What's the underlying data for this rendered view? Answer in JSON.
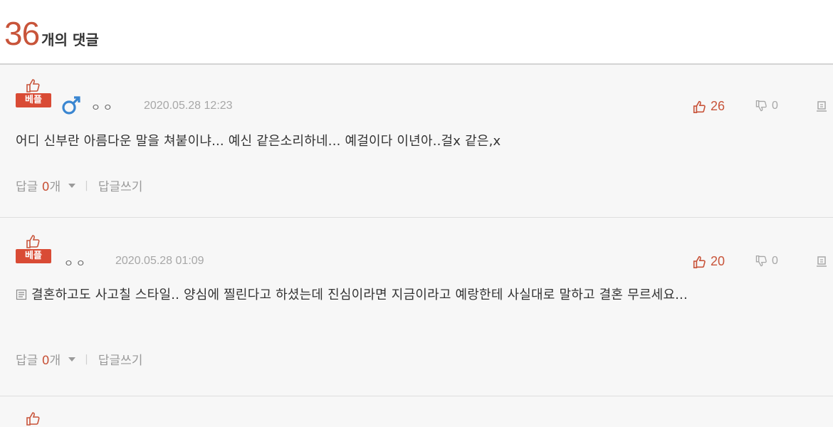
{
  "header": {
    "count": "36",
    "count_suffix": "개의 댓글"
  },
  "comments": [
    {
      "badge": "베플",
      "has_gender_icon": true,
      "author": "ㅇㅇ",
      "date": "2020.05.28 12:23",
      "likes": "26",
      "dislikes": "0",
      "text": "어디 신부란 아름다운 말을 쳐붙이냐... 예신 같은소리하네... 예걸이다 이년아..걸x 같은,x",
      "reply_label": "답글",
      "reply_count": "0",
      "reply_count_suffix": "개",
      "write_reply": "답글쓰기"
    },
    {
      "badge": "베플",
      "has_gender_icon": false,
      "author": "ㅇㅇ",
      "date": "2020.05.28 01:09",
      "likes": "20",
      "dislikes": "0",
      "text": "결혼하고도 사고칠 스타일.. 양심에 찔린다고 하셨는데 진심이라면 지금이라고 예랑한테 사실대로 말하고 결혼 무르세요...",
      "reply_label": "답글",
      "reply_count": "0",
      "reply_count_suffix": "개",
      "write_reply": "답글쓰기"
    }
  ],
  "icons": {
    "thumb": "thumbs-up-icon",
    "gender": "male-icon",
    "like": "thumbs-up-icon",
    "dislike": "thumbs-down-icon",
    "report": "report-icon",
    "doc": "document-icon",
    "caret": "caret-down-icon"
  },
  "colors": {
    "accent": "#c8543a",
    "badge": "#d94b35",
    "male_icon": "#3a86d1",
    "muted": "#a7a7a7",
    "list_bg": "#f7f7f7"
  }
}
